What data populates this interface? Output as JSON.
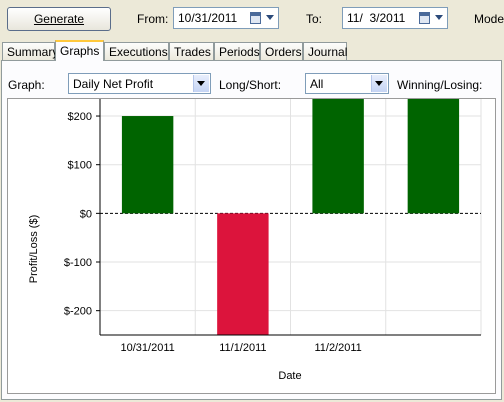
{
  "toolbar": {
    "generate_label": "Generate",
    "from_label": "From:",
    "from_date": "10/31/2011",
    "to_label": "To:",
    "to_date": "11/  3/2011",
    "mode_label": "Mode:"
  },
  "tabs": [
    {
      "label": "Summary",
      "active": false
    },
    {
      "label": "Graphs",
      "active": true
    },
    {
      "label": "Executions",
      "active": false
    },
    {
      "label": "Trades",
      "active": false
    },
    {
      "label": "Periods",
      "active": false
    },
    {
      "label": "Orders",
      "active": false
    },
    {
      "label": "Journal",
      "active": false
    }
  ],
  "filters": {
    "graph_label": "Graph:",
    "graph_value": "Daily Net Profit",
    "longshort_label": "Long/Short:",
    "longshort_value": "All",
    "winlose_label": "Winning/Losing:"
  },
  "colors": {
    "positive": "#006400",
    "negative": "#dc143c",
    "tab_highlight": "#ffc83c"
  },
  "chart_data": {
    "type": "bar",
    "categories": [
      "10/31/2011",
      "11/1/2011",
      "11/2/2011",
      "11/3/2011"
    ],
    "x_tick_labels": [
      "10/31/2011",
      "11/1/2011",
      "11/2/2011",
      ""
    ],
    "values": [
      200,
      -250,
      235,
      235
    ],
    "xlabel": "Date",
    "ylabel": "Profit/Loss ($)",
    "ylim": [
      -250,
      235
    ],
    "yticks": [
      200,
      100,
      0,
      -100,
      -200
    ],
    "ytick_labels": [
      "$200",
      "$100",
      "$0",
      "$-100",
      "$-200"
    ],
    "grid": true,
    "zero_line": "dashed"
  }
}
